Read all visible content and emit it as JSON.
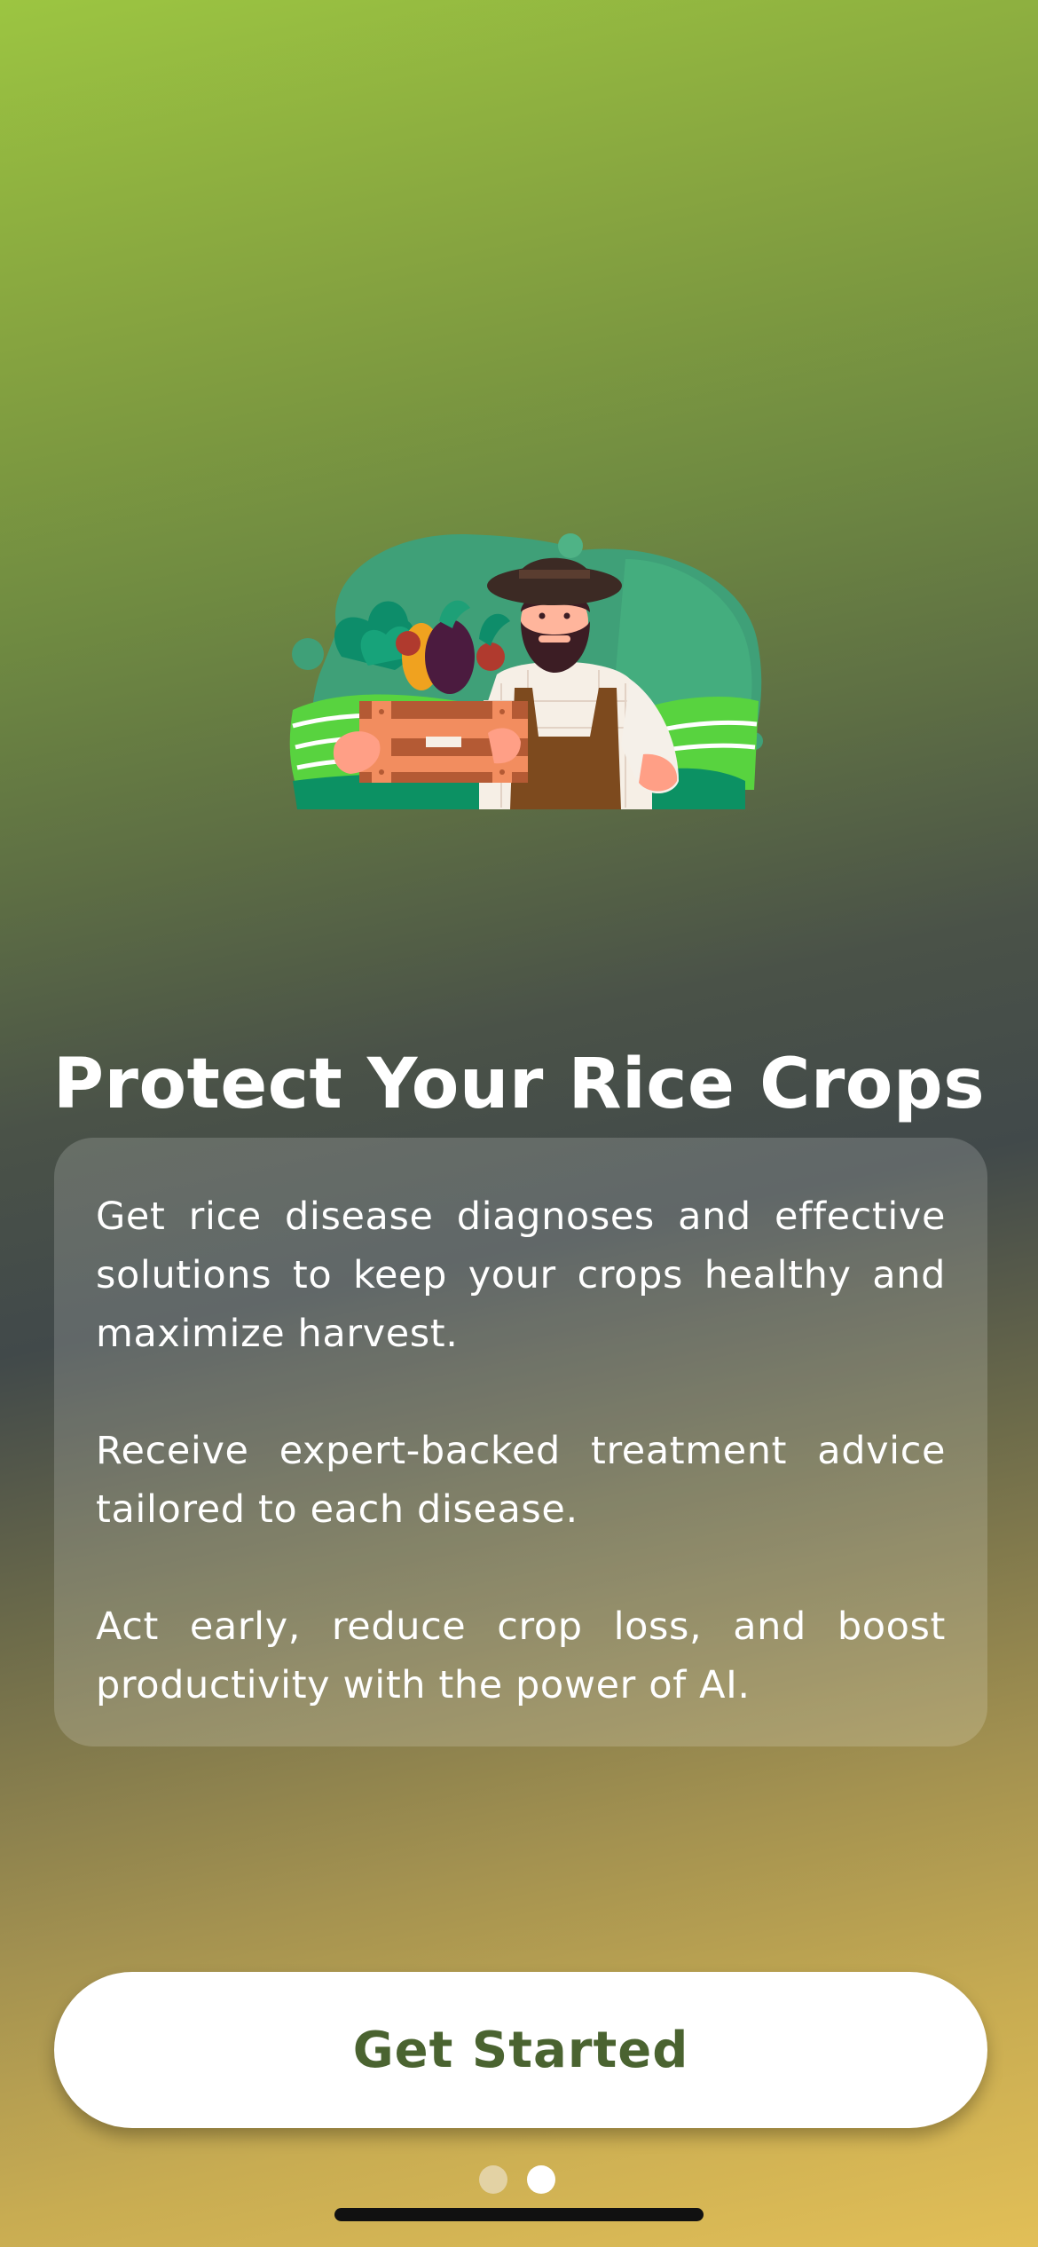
{
  "onboarding": {
    "title": "Protect Your Rice Crops",
    "paragraphs": [
      "Get rice disease diagnoses and effective solutions to keep your crops healthy and maximize harvest.",
      "Receive expert-backed treatment advice tailored to each disease.",
      "Act early, reduce crop loss, and boost productivity with the power of AI."
    ],
    "cta_label": "Get Started",
    "pagination": {
      "total": 2,
      "active_index": 1
    }
  },
  "colors": {
    "gradient_top": "#9cc541",
    "gradient_mid": "#41494a",
    "gradient_bottom": "#e2bf57",
    "cta_text": "#4a6330",
    "dot_active": "#ffffff",
    "dot_inactive": "#e3d2a4"
  },
  "icons": {
    "illustration": "farmer-with-vegetable-crate-illustration"
  }
}
